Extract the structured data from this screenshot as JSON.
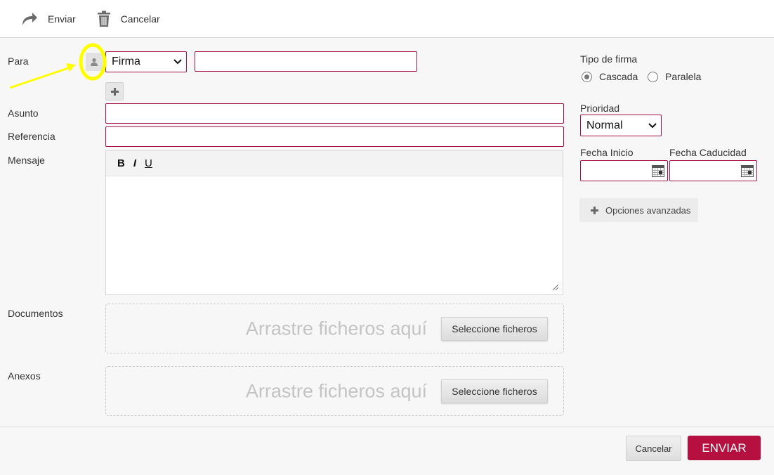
{
  "toolbar": {
    "send_label": "Enviar",
    "cancel_label": "Cancelar"
  },
  "form": {
    "to_label": "Para",
    "recipient_type": "Firma",
    "recipient_value": "",
    "subject_label": "Asunto",
    "subject_value": "",
    "reference_label": "Referencia",
    "reference_value": "",
    "message_label": "Mensaje",
    "editor": {
      "bold": "B",
      "italic": "I",
      "underline": "U"
    },
    "documents_label": "Documentos",
    "attachments_label": "Anexos",
    "drop_text": "Arrastre ficheros aquí",
    "select_files_label": "Seleccione ficheros"
  },
  "sidebar": {
    "signature_type_label": "Tipo de firma",
    "signature_options": [
      "Cascada",
      "Paralela"
    ],
    "signature_selected": "Cascada",
    "priority_label": "Prioridad",
    "priority_value": "Normal",
    "start_date_label": "Fecha Inicio",
    "end_date_label": "Fecha Caducidad",
    "advanced_label": "Opciones avanzadas"
  },
  "footer": {
    "cancel_label": "Cancelar",
    "send_label": "ENVIAR"
  },
  "colors": {
    "accent": "#b5103f",
    "border_accent": "#a4123f",
    "highlight": "#ffff00"
  }
}
